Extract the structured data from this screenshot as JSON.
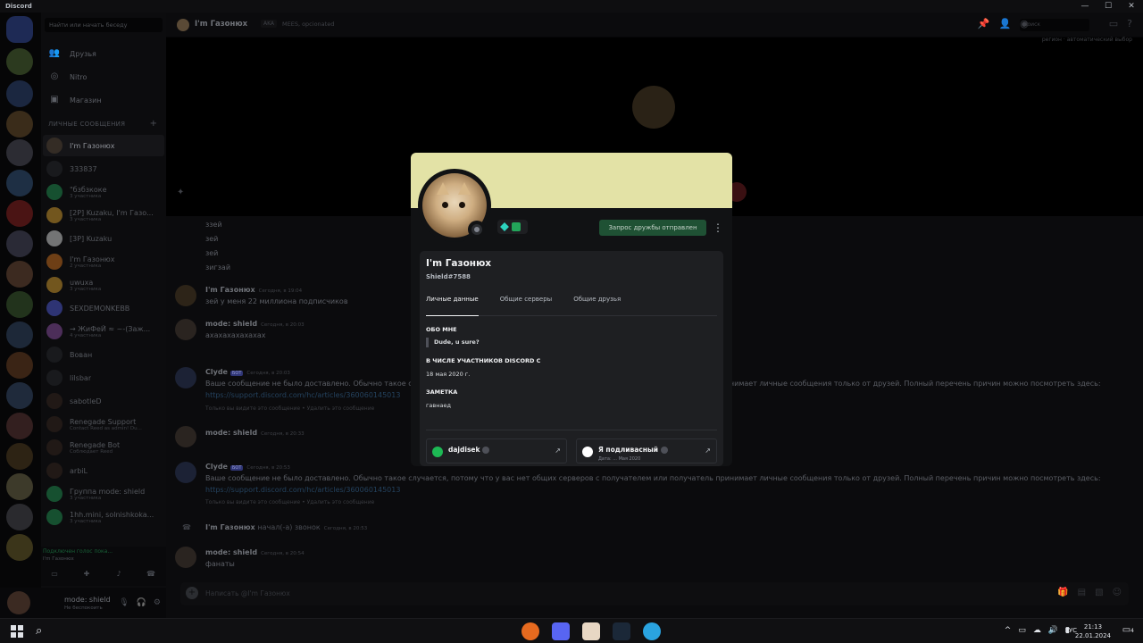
{
  "window": {
    "title": "Discord",
    "controls": [
      "—",
      "☐",
      "✕"
    ]
  },
  "sidebar": {
    "search_placeholder": "Найти или начать беседу",
    "nav": [
      {
        "label": "Друзья",
        "icon": "friends-icon"
      },
      {
        "label": "Nitro",
        "icon": "nitro-icon"
      },
      {
        "label": "Магазин",
        "icon": "shop-icon"
      }
    ],
    "dm_header": "Личные сообщения",
    "dms": [
      {
        "name": "I'm Газонюх",
        "sub": "",
        "color": "#5a4a36",
        "active": true
      },
      {
        "name": "333837",
        "sub": "",
        "color": "#2b2d31"
      },
      {
        "name": "\"бзбзкоке",
        "sub": "3 участника",
        "color": "#23a55a"
      },
      {
        "name": "[2P] Kuzaku, I'm Газо...",
        "sub": "3 участника",
        "color": "#f0b232"
      },
      {
        "name": "[3P] Kuzaku",
        "sub": "",
        "color": "#f2f3f5"
      },
      {
        "name": "I'm Газонюх",
        "sub": "2 участника",
        "color": "#e67e22"
      },
      {
        "name": "uwuxa",
        "sub": "3 участника",
        "color": "#f0b232"
      },
      {
        "name": "SEXDEMONKEBB",
        "sub": "",
        "color": "#5865f2"
      },
      {
        "name": "→ ЖиФеЙ ≈ ~-(Заж...",
        "sub": "4 участника",
        "color": "#9b59b6"
      },
      {
        "name": "Вован",
        "sub": "",
        "color": "#2b2d31"
      },
      {
        "name": "lilsbar",
        "sub": "",
        "color": "#2b2d31"
      },
      {
        "name": "sabotleD",
        "sub": "",
        "color": "#3b2a22"
      },
      {
        "name": "Renegade Support",
        "sub": "Contact Reed as admin! Du...",
        "color": "#3b2a22"
      },
      {
        "name": "Renegade Bot",
        "sub": "Соблюдает Reed",
        "color": "#3b2a22"
      },
      {
        "name": "arbiL",
        "sub": "",
        "color": "#3b2a22"
      },
      {
        "name": "Группа mode: shield",
        "sub": "3 участника",
        "color": "#23a55a"
      },
      {
        "name": "1hh.mini, solnishkoka...",
        "sub": "3 участника",
        "color": "#23a55a"
      }
    ],
    "voice": {
      "status": "Подключен голос пока...",
      "sub": "I'm Газонюх",
      "buttons": [
        "voice-video-icon",
        "voice-activity-icon",
        "voice-soundboard-icon",
        "voice-disconnect-icon"
      ]
    },
    "user": {
      "name": "mode: shield",
      "status": "Не беспокоить"
    }
  },
  "chat": {
    "header": {
      "name": "I'm Газонюх",
      "aka_label": "AKA",
      "aka_value": "MEES, opcionated",
      "search_placeholder": "Поиск"
    },
    "filter_text": "регион · автоматический выбор",
    "lines": [
      {
        "text": "ззей"
      },
      {
        "text": "зей"
      },
      {
        "text": "зей"
      },
      {
        "text": "зигзай"
      }
    ],
    "messages": [
      {
        "author": "I'm Газонюх",
        "time": "Сегодня, в 19:04",
        "text": "зей у меня 22 миллиона подписчиков"
      },
      {
        "author": "mode: shield",
        "time": "Сегодня, в 20:03",
        "text": "ахахахахахахах"
      },
      {
        "author": "Clyde",
        "bot": "БОТ",
        "time": "Сегодня, в 20:03",
        "text": "Ваше сообщение не было доставлено. Обычно такое случается, потому что у вас нет общих серверов с получателем или получатель принимает личные сообщения только от друзей. Полный перечень причин можно посмотреть здесь:",
        "link": "https://support.discord.com/hc/articles/360060145013",
        "note": "Только вы видите это сообщение • Удалить это сообщение"
      },
      {
        "author": "mode: shield",
        "time": "Сегодня, в 20:33",
        "text": ""
      },
      {
        "author": "Clyde",
        "bot": "БОТ",
        "time": "Сегодня, в 20:53",
        "text": "Ваше сообщение не было доставлено. Обычно такое случается, потому что у вас нет общих серверов с получателем или получатель принимает личные сообщения только от друзей. Полный перечень причин можно посмотреть здесь:",
        "link": "https://support.discord.com/hc/articles/360060145013",
        "note": "Только вы видите это сообщение • Удалить это сообщение"
      },
      {
        "author": "I'm Газонюх",
        "call": "начал(-а) звонок",
        "time": "Сегодня, в 20:53"
      },
      {
        "author": "mode: shield",
        "time": "Сегодня, в 20:54",
        "text": "фанаты"
      }
    ],
    "input_placeholder": "Написать @I'm Газонюх"
  },
  "profile": {
    "banner_color": "#e3e2a6",
    "display_name": "I'm Газонюх",
    "tag": "Shield#7588",
    "friend_button": "Запрос дружбы отправлен",
    "more": "⋮",
    "tabs": [
      "Личные данные",
      "Общие серверы",
      "Общие друзья"
    ],
    "about_title": "ОБО МНЕ",
    "about_text": "Dude, u sure?",
    "member_since_title": "В ЧИСЛЕ УЧАСТНИКОВ DISCORD С",
    "member_since": "18 мая 2020 г.",
    "note_title": "ЗАМЕТКА",
    "note_text": "гавнаед",
    "connections": [
      {
        "name": "dajdisek",
        "service": "spotify-icon",
        "color": "#1db954",
        "sub": ""
      },
      {
        "name": "Я подливасный",
        "service": "steam-icon",
        "color": "#ffffff",
        "sub": "Дата: ... Мая 2020"
      }
    ]
  },
  "taskbar": {
    "lang": "РУС",
    "time": "21:13",
    "date": "22.01.2024",
    "notifications": "4"
  }
}
